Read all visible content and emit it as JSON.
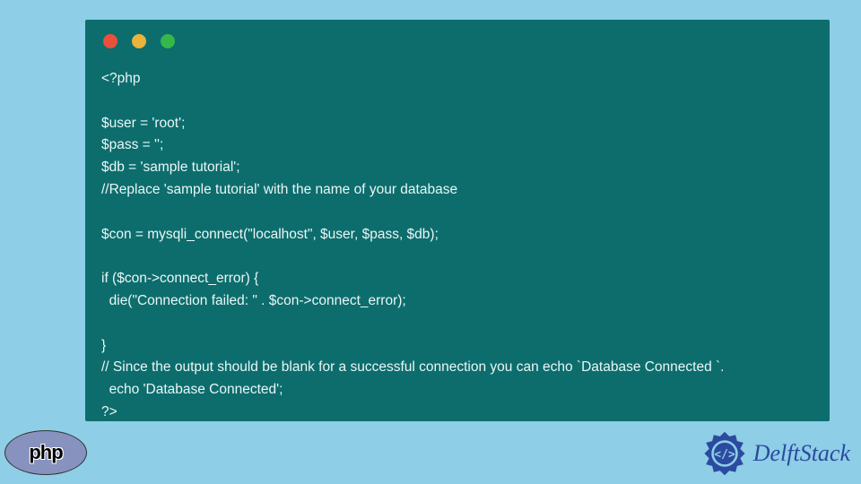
{
  "traffic_lights": {
    "red": "#e9503c",
    "yellow": "#e9b33c",
    "green": "#35b84a"
  },
  "code": {
    "line1": "<?php",
    "line2": "",
    "line3": "$user = 'root';",
    "line4": "$pass = '';",
    "line5": "$db = 'sample tutorial';",
    "line6": "//Replace 'sample tutorial' with the name of your database",
    "line7": "",
    "line8": "$con = mysqli_connect(\"localhost\", $user, $pass, $db);",
    "line9": "",
    "line10": "if ($con->connect_error) {",
    "line11": "  die(\"Connection failed: \" . $con->connect_error);",
    "line12": "",
    "line13": "}",
    "line14": "// Since the output should be blank for a successful connection you can echo `Database Connected `.",
    "line15": "  echo 'Database Connected';",
    "line16": "?>"
  },
  "php_logo_text": "php",
  "brand_text": "DelftStack"
}
